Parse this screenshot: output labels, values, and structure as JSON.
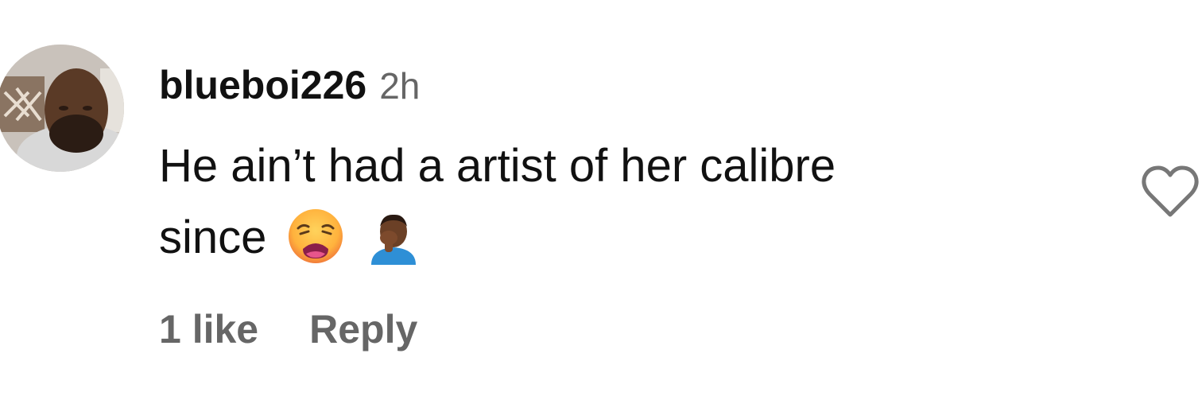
{
  "comment": {
    "username": "blueboi226",
    "timestamp": "2h",
    "text_line_1": "He ain’t had a artist of her calibre",
    "text_line_2": "since",
    "emojis": [
      "weary-face-emoji",
      "man-facepalming-emoji"
    ],
    "likes_label": "1 like",
    "reply_label": "Reply",
    "like_icon": "heart-outline-icon"
  },
  "colors": {
    "username": "#111111",
    "secondary_text": "#666666",
    "heart_stroke": "#777777",
    "background": "#ffffff"
  }
}
